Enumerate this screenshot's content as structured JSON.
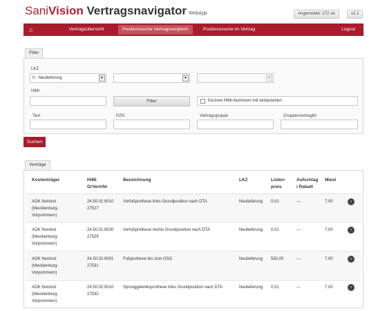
{
  "header": {
    "brand_sani": "Sani",
    "brand_vision": "Vision",
    "brand_rest": " Vertragsnavigator",
    "brand_sub": "WebApp",
    "user_status": "Angemeldet: 272 sic",
    "version": "v2.2"
  },
  "nav": {
    "home_icon": "home-icon",
    "items": [
      "Vertragsübersicht",
      "Positionssuche Vertragsvergleich",
      "Positionssuche im Vertrag"
    ],
    "active_index": 1,
    "logout": "Logout"
  },
  "filter": {
    "tab": "Filter",
    "lkz_label": "LKZ",
    "lkz_value": "0 - Neulieferung",
    "select2_value": "",
    "select3_value": "",
    "himi_label": "HiMi",
    "himi_value": "",
    "filter_button": "Filter",
    "checkbox_label": "Kürzere HiMi-Nummern mit einbeziehen",
    "checkbox_checked": false,
    "text_label": "Text",
    "pzn_label": "PZN",
    "vertragsgruppe_label": "Vertragsgruppe",
    "gruppenvertragnr_label": "GruppenvertragNr"
  },
  "search_button": "Suchen",
  "vertraege": {
    "tab": "Verträge",
    "columns": {
      "kostentraeger": "Kostenträger",
      "himi_1": "HiMi",
      "himi_2": "GrVertrNr",
      "bezeichnung": "Bezeichnung",
      "lkz": "LKZ",
      "listen_1": "Listen-",
      "listen_2": "preis",
      "aufschlag_1": "Aufschlag",
      "aufschlag_2": "/ Rabatt",
      "mwst": "Mwst"
    },
    "rows": [
      {
        "kt": [
          "AOK Nordost",
          "(Mecklenburg-",
          "Vorpommern)"
        ],
        "himi": [
          "24.50.01.9010",
          "27527"
        ],
        "bez": "Vorfußprothese links Grundposition nach DTA",
        "lkz": "Neulieferung",
        "preis": "0,01",
        "aufschlag": "---",
        "mwst": "7,00"
      },
      {
        "kt": [
          "AOK Nordost",
          "(Mecklenburg-",
          "Vorpommern)"
        ],
        "himi": [
          "24.50.01.9020",
          "27529"
        ],
        "bez": "Vorfußprothese rechts Grundposition nach DTA",
        "lkz": "Neulieferung",
        "preis": "0,01",
        "aufschlag": "---",
        "mwst": "7,00"
      },
      {
        "kt": [
          "AOK Nordost",
          "(Mecklenburg-",
          "Vorpommern)"
        ],
        "himi": [
          "24.50.02.9001",
          "27531"
        ],
        "bez": "Fußprothese bis zum OSG",
        "lkz": "Neulieferung",
        "preis": "550,00",
        "aufschlag": "---",
        "mwst": "7,00"
      },
      {
        "kt": [
          "AOK Nordost",
          "(Mecklenburg-",
          "Vorpommern)"
        ],
        "himi": [
          "24.50.02.9010",
          "27532"
        ],
        "bez": "Sprunggelenksprothese links Grundposition nach DTA",
        "lkz": "Neulieferung",
        "preis": "0,01",
        "aufschlag": "---",
        "mwst": "7,00"
      }
    ],
    "row_action_icon": "chevron-right-icon"
  }
}
